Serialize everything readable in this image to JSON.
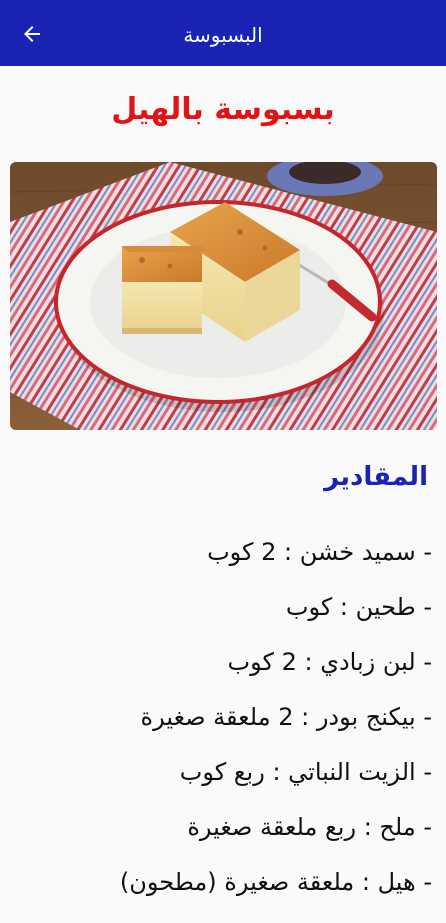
{
  "appbar": {
    "title": "البسبوسة",
    "back_icon": "arrow-left-icon",
    "color": "#1a23b4"
  },
  "recipe": {
    "title": "بسبوسة بالهيل",
    "title_color": "#e01414",
    "image_alt": "بسبوسة بالهيل"
  },
  "ingredients": {
    "heading": "المقادير",
    "heading_color": "#1a23b4",
    "items": [
      "- سميد خشن : 2 كوب",
      "- طحين : كوب",
      "- لبن زبادي : 2 كوب",
      "- بيكنج بودر : 2 ملعقة صغيرة",
      "- الزيت النباتي : ربع كوب",
      "- ملح : ربع ملعقة صغيرة",
      "- هيل : ملعقة صغيرة (مطحون)"
    ]
  }
}
